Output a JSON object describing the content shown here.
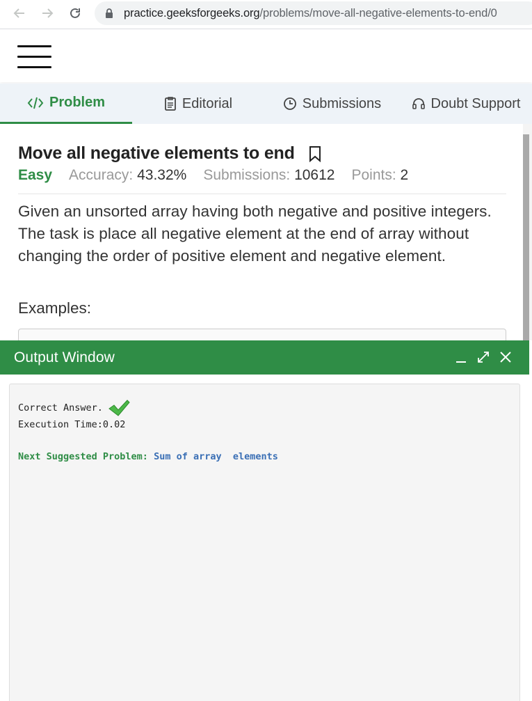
{
  "browser": {
    "url_host": "practice.geeksforgeeks.org",
    "url_path": "/problems/move-all-negative-elements-to-end/0"
  },
  "tabs": [
    {
      "label": "Problem",
      "icon": "code-icon",
      "active": true
    },
    {
      "label": "Editorial",
      "icon": "document-icon",
      "active": false
    },
    {
      "label": "Submissions",
      "icon": "clock-icon",
      "active": false
    },
    {
      "label": "Doubt Support",
      "icon": "headset-icon",
      "active": false
    }
  ],
  "problem": {
    "title": "Move all negative elements to end",
    "difficulty": "Easy",
    "accuracy_label": "Accuracy:",
    "accuracy_value": "43.32%",
    "submissions_label": "Submissions:",
    "submissions_value": "10612",
    "points_label": "Points:",
    "points_value": "2",
    "description": "Given an unsorted array having both negative and positive integers. The task is place all negative element at the end of array without changing the order of positive element and negative element.",
    "examples_label": "Examples:"
  },
  "output_window": {
    "title": "Output Window",
    "result": "Correct Answer.",
    "execution_time": "Execution Time:0.02",
    "next_label": "Next Suggested Problem:",
    "next_link": "Sum of array  elements"
  },
  "colors": {
    "brand_green": "#2f8d46",
    "link_blue": "#3a6fb5",
    "tab_bg": "#eef3f8"
  }
}
